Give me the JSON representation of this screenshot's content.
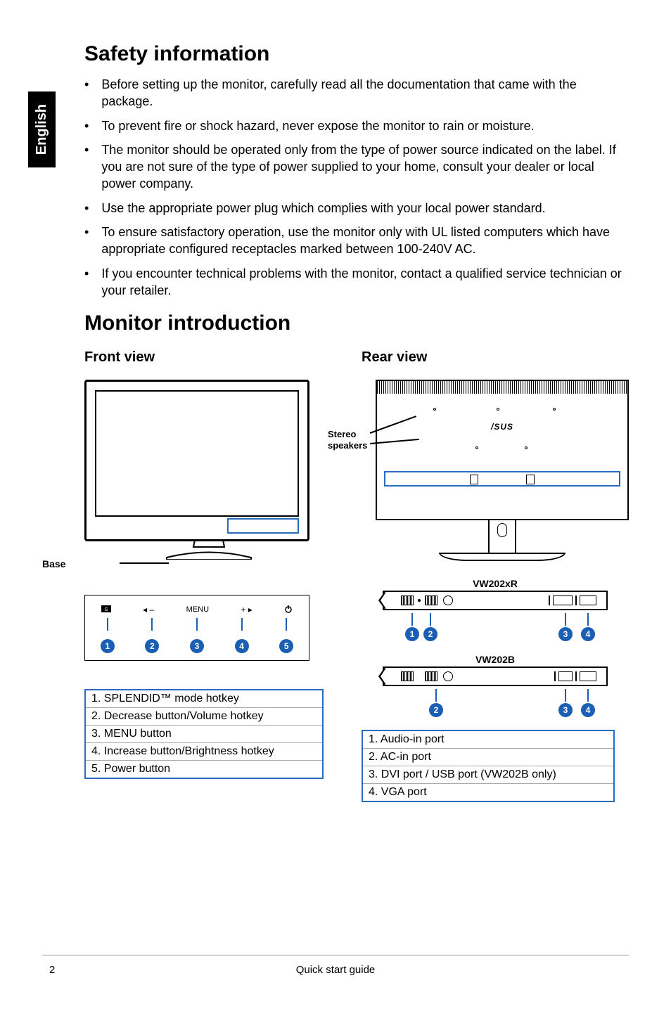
{
  "language_tab": "English",
  "heading_safety": "Safety information",
  "safety_bullets": [
    "Before setting up the monitor, carefully read all the documentation that came with the package.",
    "To prevent fire or shock hazard, never expose the monitor to rain or moisture.",
    "The monitor should be operated only from the type of power source indicated on the label. If you are not sure of the type of power supplied to your home, consult your dealer or local power company.",
    "Use the appropriate power plug which complies with your local power standard.",
    "To ensure satisfactory operation, use the monitor only with UL listed  computers which have appropriate configured receptacles marked between 100-240V AC.",
    "If you encounter technical problems with the monitor, contact a qualified service technician or your retailer."
  ],
  "heading_intro": "Monitor introduction",
  "front_view": "Front view",
  "rear_view": "Rear view",
  "base_label": "Base",
  "stereo_label_1": "Stereo",
  "stereo_label_2": "speakers",
  "front_buttons": {
    "menu_label": "MENU"
  },
  "front_callouts": [
    "1",
    "2",
    "3",
    "4",
    "5"
  ],
  "front_legend": [
    "1. SPLENDID™ mode hotkey",
    "2. Decrease button/Volume hotkey",
    "3. MENU button",
    "4. Increase button/Brightness hotkey",
    "5. Power button"
  ],
  "rear_panels": {
    "panel_a_label": "VW202xR",
    "panel_a_callouts": [
      "1",
      "2",
      "3",
      "4"
    ],
    "panel_b_label": "VW202B",
    "panel_b_callouts": [
      "2",
      "3",
      "4"
    ]
  },
  "rear_legend": [
    "1. Audio-in port",
    "2. AC-in port",
    "3. DVI port / USB port (VW202B only)",
    "4. VGA port"
  ],
  "rear_logo": "/SUS",
  "footer_text": "Quick start guide",
  "page_number": "2"
}
